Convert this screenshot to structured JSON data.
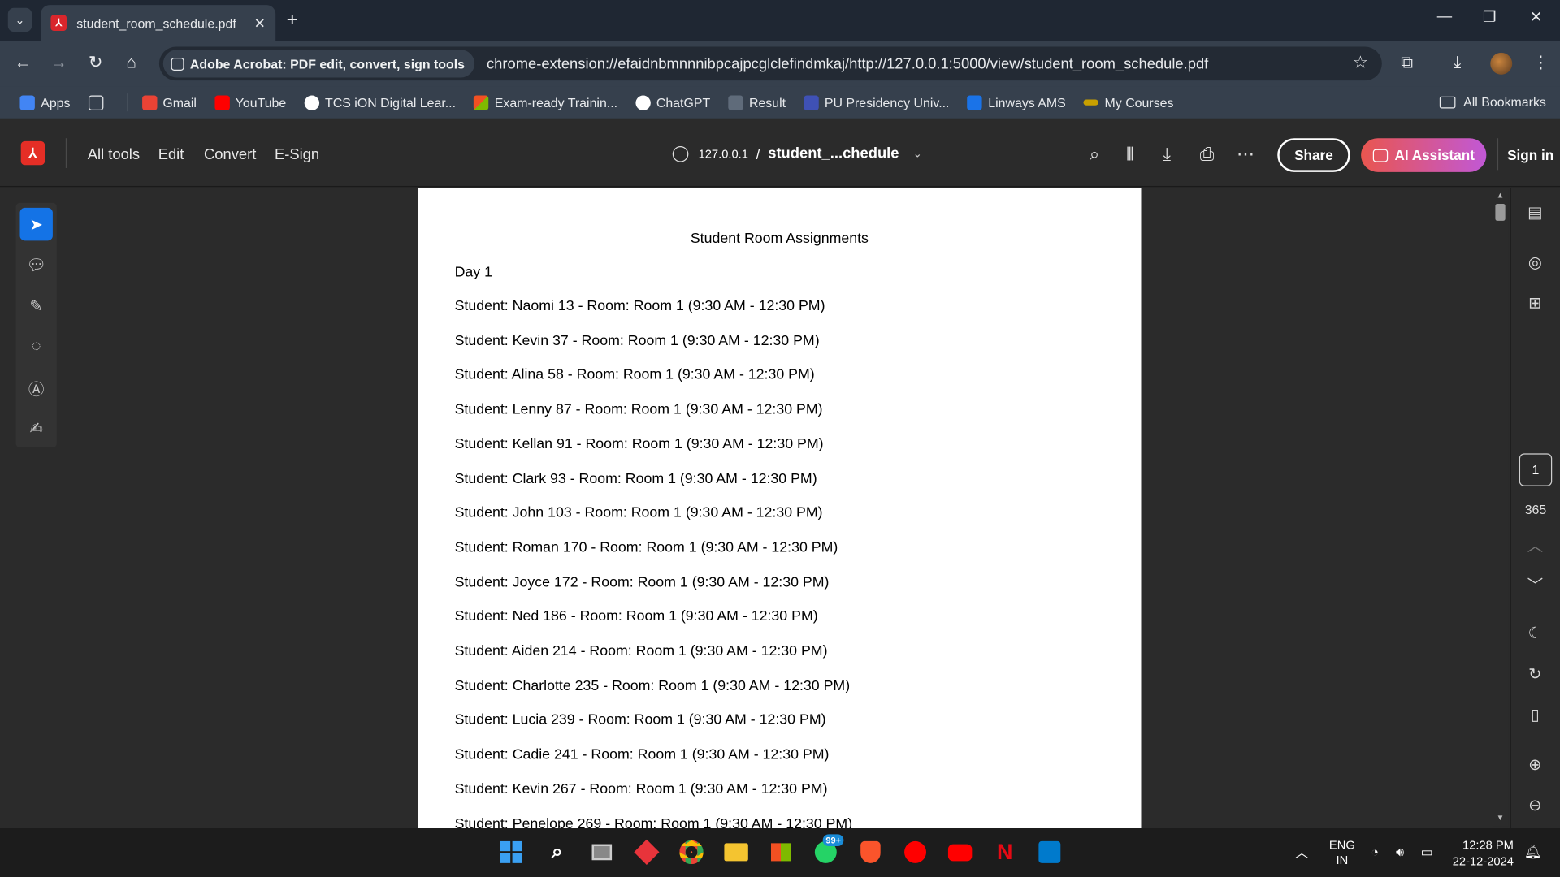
{
  "browser": {
    "tab_title": "student_room_schedule.pdf",
    "extension_chip": "Adobe Acrobat: PDF edit, convert, sign tools",
    "url": "chrome-extension://efaidnbmnnnibpcajpcglclefindmkaj/http://127.0.0.1:5000/view/student_room_schedule.pdf",
    "bookmarks": [
      {
        "label": "Apps",
        "color": "#4285f4"
      },
      {
        "label": "Gmail",
        "color": "#ea4335"
      },
      {
        "label": "YouTube",
        "color": "#ff0000"
      },
      {
        "label": "TCS iON Digital Lear...",
        "color": "#ffffff"
      },
      {
        "label": "Exam-ready Trainin...",
        "color": "#f4b400"
      },
      {
        "label": "ChatGPT",
        "color": "#ffffff"
      },
      {
        "label": "Result",
        "color": "#5f6b7a"
      },
      {
        "label": "PU Presidency Univ...",
        "color": "#3f51b5"
      },
      {
        "label": "Linways AMS",
        "color": "#1a73e8"
      },
      {
        "label": "My Courses",
        "color": "#c8a000"
      }
    ],
    "all_bookmarks": "All Bookmarks"
  },
  "acrobat": {
    "menu": [
      "All tools",
      "Edit",
      "Convert",
      "E-Sign"
    ],
    "host": "127.0.0.1",
    "separator": "/",
    "file_short": "student_...chedule",
    "share": "Share",
    "ai_assistant": "AI Assistant",
    "sign_in": "Sign in",
    "current_page": "1",
    "page_count": "365"
  },
  "document": {
    "title": "Student Room Assignments",
    "day": "Day 1",
    "rows": [
      "Student: Naomi 13 - Room: Room 1 (9:30 AM - 12:30 PM)",
      "Student: Kevin 37 - Room: Room 1 (9:30 AM - 12:30 PM)",
      "Student: Alina 58 - Room: Room 1 (9:30 AM - 12:30 PM)",
      "Student: Lenny 87 - Room: Room 1 (9:30 AM - 12:30 PM)",
      "Student: Kellan 91 - Room: Room 1 (9:30 AM - 12:30 PM)",
      "Student: Clark 93 - Room: Room 1 (9:30 AM - 12:30 PM)",
      "Student: John 103 - Room: Room 1 (9:30 AM - 12:30 PM)",
      "Student: Roman 170 - Room: Room 1 (9:30 AM - 12:30 PM)",
      "Student: Joyce 172 - Room: Room 1 (9:30 AM - 12:30 PM)",
      "Student: Ned 186 - Room: Room 1 (9:30 AM - 12:30 PM)",
      "Student: Aiden 214 - Room: Room 1 (9:30 AM - 12:30 PM)",
      "Student: Charlotte 235 - Room: Room 1 (9:30 AM - 12:30 PM)",
      "Student: Lucia 239 - Room: Room 1 (9:30 AM - 12:30 PM)",
      "Student: Cadie 241 - Room: Room 1 (9:30 AM - 12:30 PM)",
      "Student: Kevin 267 - Room: Room 1 (9:30 AM - 12:30 PM)",
      "Student: Penelope 269 - Room: Room 1 (9:30 AM - 12:30 PM)"
    ]
  },
  "taskbar": {
    "whatsapp_badge": "99+",
    "lang": "ENG",
    "region": "IN",
    "time": "12:28 PM",
    "date": "22-12-2024"
  },
  "colors": {
    "accent": "#1473e6",
    "acrobat_red": "#e52e26"
  }
}
